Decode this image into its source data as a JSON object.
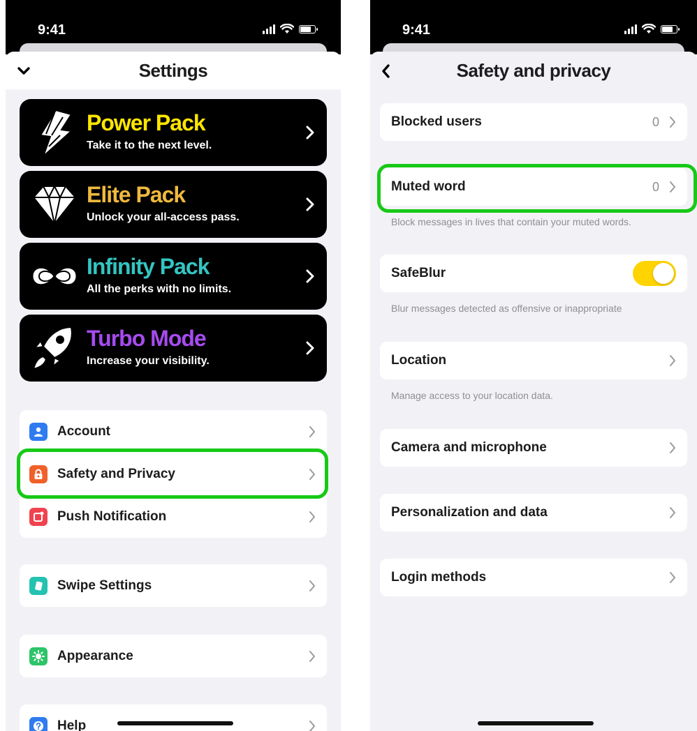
{
  "left": {
    "status": {
      "time": "9:41"
    },
    "header": {
      "title": "Settings"
    },
    "packs": [
      {
        "title": "Power Pack",
        "subtitle": "Take it to the next level.",
        "color": "#ffe600"
      },
      {
        "title": "Elite Pack",
        "subtitle": "Unlock your all-access pass.",
        "color": "#f0b93c"
      },
      {
        "title": "Infinity Pack",
        "subtitle": "All the perks with no limits.",
        "color": "#33c5c2"
      },
      {
        "title": "Turbo Mode",
        "subtitle": "Increase your visibility.",
        "color": "#a64bf0"
      }
    ],
    "menu": {
      "account": "Account",
      "safety": "Safety and Privacy",
      "push": "Push Notification",
      "swipe": "Swipe Settings",
      "appearance": "Appearance",
      "help": "Help"
    },
    "icon_colors": {
      "account": "#2f7bef",
      "safety": "#f0602a",
      "push": "#f0434f",
      "swipe": "#24c2b0",
      "appearance": "#2dc46a",
      "help": "#2f7bef"
    }
  },
  "right": {
    "status": {
      "time": "9:41"
    },
    "header": {
      "title": "Safety and privacy"
    },
    "blocked": {
      "label": "Blocked users",
      "value": "0"
    },
    "muted": {
      "label": "Muted word",
      "value": "0",
      "footer": "Block messages in lives that contain your muted words."
    },
    "safeblur": {
      "label": "SafeBlur",
      "enabled": true,
      "footer": "Blur messages detected as offensive or inappropriate"
    },
    "location": {
      "label": "Location",
      "footer": "Manage access to your location data."
    },
    "camera": {
      "label": "Camera and microphone"
    },
    "personalization": {
      "label": "Personalization and data"
    },
    "login": {
      "label": "Login methods"
    }
  },
  "highlight_color": "#17c917",
  "toggle_color": "#ffd400"
}
